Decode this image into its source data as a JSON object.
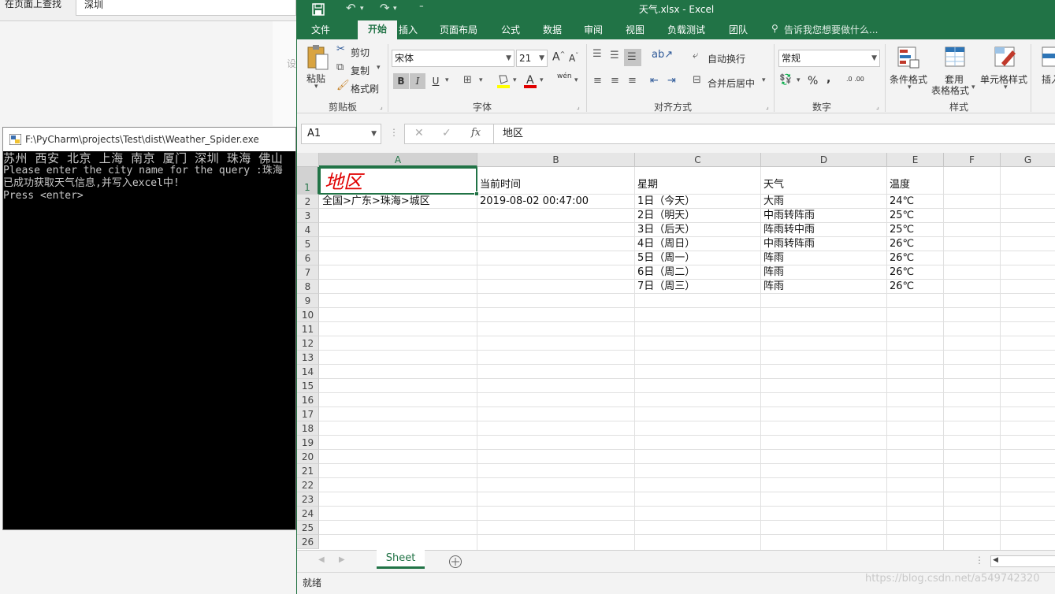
{
  "browser": {
    "find_label": "在页面上查找",
    "find_value": "深圳",
    "side_glyph": "设"
  },
  "console": {
    "title": "F:\\PyCharm\\projects\\Test\\dist\\Weather_Spider.exe",
    "lines": [
      "苏州 西安 北京 上海 南京 厦门 深圳 珠海 佛山",
      "Please enter the city name for the query :珠海",
      "已成功获取天气信息,并写入excel中!",
      "Press <enter>"
    ]
  },
  "excel": {
    "title": "天气.xlsx - Excel",
    "tabs": [
      "文件",
      "开始",
      "插入",
      "页面布局",
      "公式",
      "数据",
      "审阅",
      "视图",
      "负载测试",
      "团队"
    ],
    "active_tab": "开始",
    "tell_me": "告诉我您想要做什么...",
    "ribbon": {
      "clipboard": {
        "paste": "粘贴",
        "cut": "剪切",
        "copy": "复制",
        "format_painter": "格式刷",
        "label": "剪贴板"
      },
      "font": {
        "name": "宋体",
        "size": "21",
        "bold": "B",
        "italic": "I",
        "underline": "U",
        "label": "字体",
        "phonetic": "wén"
      },
      "alignment": {
        "wrap": "自动换行",
        "merge": "合并后居中",
        "label": "对齐方式"
      },
      "number": {
        "format": "常规",
        "percent": "%",
        "comma": ",",
        "inc_dec": ".0 .00",
        "label": "数字"
      },
      "styles": {
        "conditional": "条件格式",
        "table_line1": "套用",
        "table_line2": "表格格式",
        "cell_styles": "单元格样式",
        "label": "样式"
      },
      "cells": {
        "insert": "插入"
      }
    },
    "namebox": "A1",
    "formula": "地区",
    "columns": [
      "A",
      "B",
      "C",
      "D",
      "E",
      "F",
      "G"
    ],
    "row_numbers": [
      "1",
      "2",
      "3",
      "4",
      "5",
      "6",
      "7",
      "8",
      "9",
      "10",
      "11",
      "12",
      "13",
      "14",
      "15",
      "16",
      "17",
      "18",
      "19",
      "20",
      "21",
      "22",
      "23",
      "24",
      "25",
      "26"
    ],
    "headers": {
      "a1": "地区",
      "b1": "当前时间",
      "c1": "星期",
      "d1": "天气",
      "e1": "温度"
    },
    "rows": [
      {
        "a": "全国>广东>珠海>城区",
        "b": "2019-08-02 00:47:00",
        "c": "1日（今天）",
        "d": "大雨",
        "e": "24℃"
      },
      {
        "a": "",
        "b": "",
        "c": "2日（明天）",
        "d": "中雨转阵雨",
        "e": "25℃"
      },
      {
        "a": "",
        "b": "",
        "c": "3日（后天）",
        "d": "阵雨转中雨",
        "e": "25℃"
      },
      {
        "a": "",
        "b": "",
        "c": "4日（周日）",
        "d": "中雨转阵雨",
        "e": "26℃"
      },
      {
        "a": "",
        "b": "",
        "c": "5日（周一）",
        "d": "阵雨",
        "e": "26℃"
      },
      {
        "a": "",
        "b": "",
        "c": "6日（周二）",
        "d": "阵雨",
        "e": "26℃"
      },
      {
        "a": "",
        "b": "",
        "c": "7日（周三）",
        "d": "阵雨",
        "e": "26℃"
      }
    ],
    "sheet_tab": "Sheet",
    "status": "就绪",
    "watermark": "https://blog.csdn.net/a549742320"
  }
}
